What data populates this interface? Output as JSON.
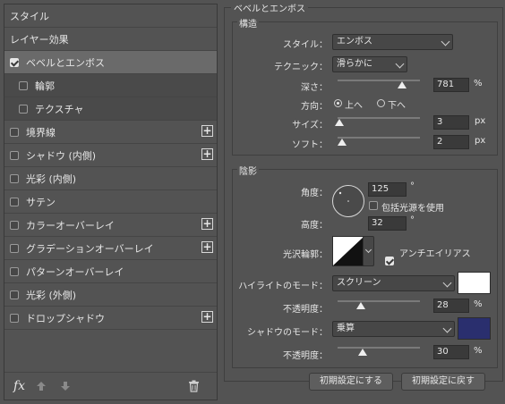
{
  "layer_style_list": {
    "items": [
      {
        "label": "スタイル",
        "checkbox": false,
        "plus": false,
        "selected": false,
        "sub": false
      },
      {
        "label": "レイヤー効果",
        "checkbox": false,
        "plus": false,
        "selected": false,
        "sub": false
      },
      {
        "label": "ベベルとエンボス",
        "checkbox": true,
        "checked": true,
        "plus": false,
        "selected": true,
        "sub": false
      },
      {
        "label": "輪郭",
        "checkbox": true,
        "checked": false,
        "plus": false,
        "selected": false,
        "sub": true
      },
      {
        "label": "テクスチャ",
        "checkbox": true,
        "checked": false,
        "plus": false,
        "selected": false,
        "sub": true
      },
      {
        "label": "境界線",
        "checkbox": true,
        "checked": false,
        "plus": true,
        "selected": false,
        "sub": false
      },
      {
        "label": "シャドウ (内側)",
        "checkbox": true,
        "checked": false,
        "plus": true,
        "selected": false,
        "sub": false
      },
      {
        "label": "光彩 (内側)",
        "checkbox": true,
        "checked": false,
        "plus": false,
        "selected": false,
        "sub": false
      },
      {
        "label": "サテン",
        "checkbox": true,
        "checked": false,
        "plus": false,
        "selected": false,
        "sub": false
      },
      {
        "label": "カラーオーバーレイ",
        "checkbox": true,
        "checked": false,
        "plus": true,
        "selected": false,
        "sub": false
      },
      {
        "label": "グラデーションオーバーレイ",
        "checkbox": true,
        "checked": false,
        "plus": true,
        "selected": false,
        "sub": false
      },
      {
        "label": "パターンオーバーレイ",
        "checkbox": true,
        "checked": false,
        "plus": false,
        "selected": false,
        "sub": false
      },
      {
        "label": "光彩 (外側)",
        "checkbox": true,
        "checked": false,
        "plus": false,
        "selected": false,
        "sub": false
      },
      {
        "label": "ドロップシャドウ",
        "checkbox": true,
        "checked": false,
        "plus": true,
        "selected": false,
        "sub": false
      }
    ],
    "footer": {
      "fx_label": "fx"
    }
  },
  "bevel_panel": {
    "title": "ベベルとエンボス",
    "structure": {
      "title": "構造",
      "style_label": "スタイル：",
      "style_value": "エンボス",
      "technique_label": "テクニック：",
      "technique_value": "滑らかに",
      "depth_label": "深さ：",
      "depth_value": "781",
      "depth_unit": "%",
      "depth_level": 0.78,
      "direction_label": "方向：",
      "direction_up": "上へ",
      "direction_down": "下へ",
      "size_label": "サイズ：",
      "size_value": "3",
      "size_unit": "px",
      "size_level": 0.02,
      "soften_label": "ソフト：",
      "soften_value": "2",
      "soften_unit": "px",
      "soften_level": 0.05
    },
    "shading": {
      "title": "陰影",
      "angle_label": "角度：",
      "angle_value": "125",
      "angle_unit": "°",
      "global_light_label": "包括光源を使用",
      "altitude_label": "高度：",
      "altitude_value": "32",
      "altitude_unit": "°",
      "gloss_contour_label": "光沢輪郭：",
      "antialias_label": "アンチエイリアス",
      "highlight_mode_label": "ハイライトのモード：",
      "highlight_mode_value": "スクリーン",
      "highlight_color": "#ffffff",
      "highlight_opacity_label": "不透明度：",
      "highlight_opacity_value": "28",
      "highlight_opacity_unit": "%",
      "highlight_opacity_level": 0.28,
      "shadow_mode_label": "シャドウのモード：",
      "shadow_mode_value": "乗算",
      "shadow_color": "#2a2f6e",
      "shadow_opacity_label": "不透明度：",
      "shadow_opacity_value": "30",
      "shadow_opacity_unit": "%",
      "shadow_opacity_level": 0.3
    },
    "buttons": {
      "make_default": "初期設定にする",
      "reset_default": "初期設定に戻す"
    }
  }
}
